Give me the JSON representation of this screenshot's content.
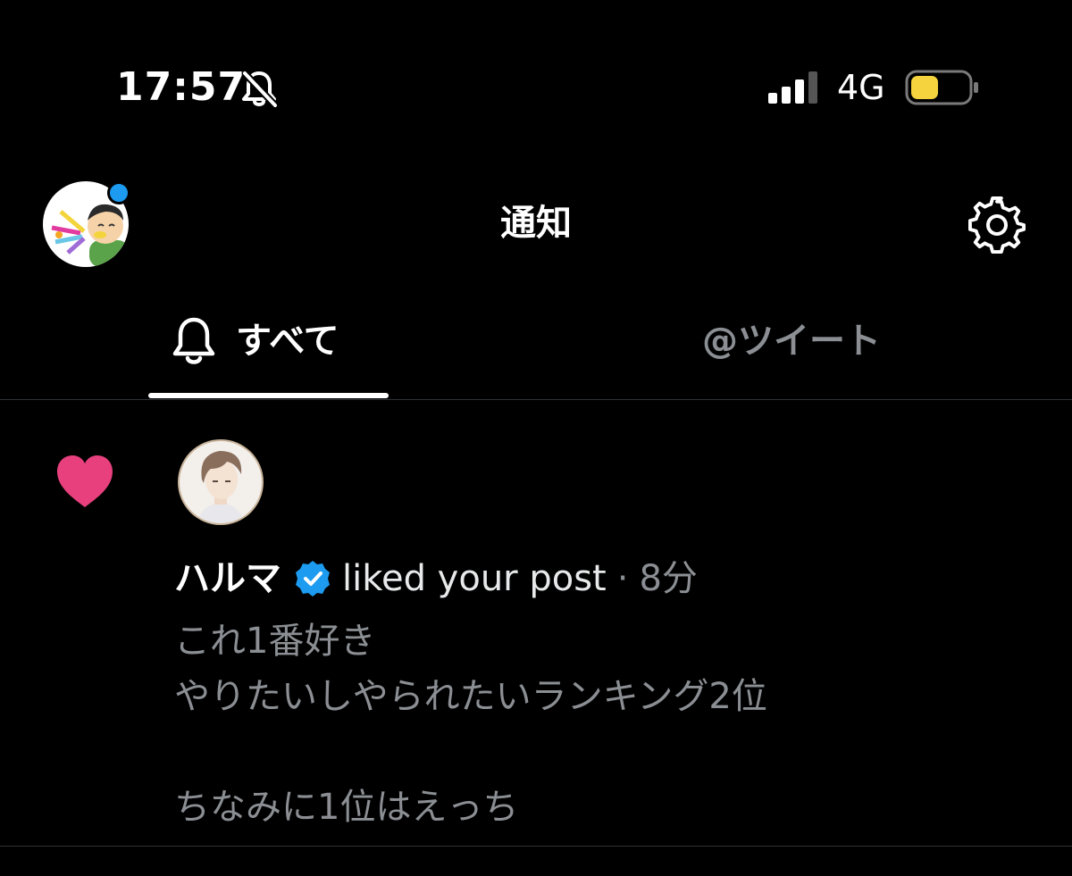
{
  "status_bar": {
    "time": "17:57",
    "network": "4G",
    "icons": [
      "mute-bell-icon",
      "signal-icon",
      "battery-icon"
    ],
    "battery_color": "#f5d33f"
  },
  "header": {
    "title": "通知",
    "left": "profile-avatar",
    "right": "settings-gear-icon",
    "unread_dot_color": "#1d9bf0"
  },
  "tabs": [
    {
      "label": "すべて",
      "icon": "bell-icon",
      "active": true
    },
    {
      "label": "@ツイート",
      "active": false
    }
  ],
  "notifications": [
    {
      "type": "like",
      "icon": "heart-icon",
      "icon_color": "#e8407d",
      "user_name": "ハルマ",
      "verified": true,
      "verified_color": "#1d9bf0",
      "action": "liked your post",
      "separator": "·",
      "time": "8分",
      "post_lines": [
        "これ1番好き",
        "やりたいしやられたいランキング2位",
        "",
        "ちなみに1位はえっち"
      ]
    }
  ]
}
